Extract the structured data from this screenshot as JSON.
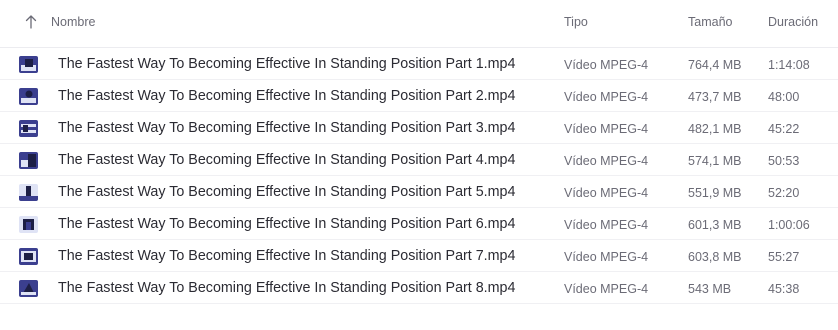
{
  "header": {
    "sort_icon": "arrow-up-icon",
    "name": "Nombre",
    "type": "Tipo",
    "size": "Tamaño",
    "duration": "Duración"
  },
  "files": [
    {
      "name": "The Fastest Way To Becoming Effective In Standing Position Part 1.mp4",
      "type": "Vídeo MPEG-4",
      "size": "764,4 MB",
      "duration": "1:14:08",
      "thumb_icon": "video-thumbnail-icon"
    },
    {
      "name": "The Fastest Way To Becoming Effective In Standing Position Part 2.mp4",
      "type": "Vídeo MPEG-4",
      "size": "473,7 MB",
      "duration": "48:00",
      "thumb_icon": "video-thumbnail-icon"
    },
    {
      "name": "The Fastest Way To Becoming Effective In Standing Position Part 3.mp4",
      "type": "Vídeo MPEG-4",
      "size": "482,1 MB",
      "duration": "45:22",
      "thumb_icon": "video-thumbnail-icon"
    },
    {
      "name": "The Fastest Way To Becoming Effective In Standing Position Part 4.mp4",
      "type": "Vídeo MPEG-4",
      "size": "574,1 MB",
      "duration": "50:53",
      "thumb_icon": "video-thumbnail-icon"
    },
    {
      "name": "The Fastest Way To Becoming Effective In Standing Position Part 5.mp4",
      "type": "Vídeo MPEG-4",
      "size": "551,9 MB",
      "duration": "52:20",
      "thumb_icon": "video-thumbnail-icon"
    },
    {
      "name": "The Fastest Way To Becoming Effective In Standing Position Part 6.mp4",
      "type": "Vídeo MPEG-4",
      "size": "601,3 MB",
      "duration": "1:00:06",
      "thumb_icon": "video-thumbnail-icon"
    },
    {
      "name": "The Fastest Way To Becoming Effective In Standing Position Part 7.mp4",
      "type": "Vídeo MPEG-4",
      "size": "603,8 MB",
      "duration": "55:27",
      "thumb_icon": "video-thumbnail-icon"
    },
    {
      "name": "The Fastest Way To Becoming Effective In Standing Position Part 8.mp4",
      "type": "Vídeo MPEG-4",
      "size": "543 MB",
      "duration": "45:38",
      "thumb_icon": "video-thumbnail-icon"
    }
  ],
  "colors": {
    "thumb_bg": "#3b3f8f",
    "thumb_light": "#dfe3f5",
    "thumb_dark": "#1d1f45"
  }
}
